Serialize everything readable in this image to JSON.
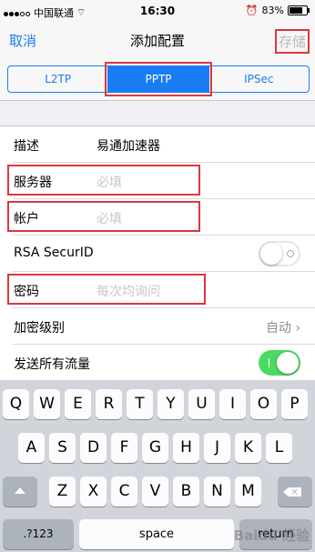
{
  "status": {
    "carrier": "中国联通",
    "time": "16:30",
    "battery": "83%"
  },
  "nav": {
    "cancel": "取消",
    "title": "添加配置",
    "save": "存储"
  },
  "segments": [
    "L2TP",
    "PPTP",
    "IPSec"
  ],
  "form": {
    "description": {
      "label": "描述",
      "value": "易通加速器"
    },
    "server": {
      "label": "服务器",
      "placeholder": "必填"
    },
    "account": {
      "label": "帐户",
      "placeholder": "必填"
    },
    "rsa": {
      "label": "RSA SecurID",
      "on": false
    },
    "password": {
      "label": "密码",
      "placeholder": "每次均询问"
    },
    "encryption": {
      "label": "加密级别",
      "value": "自动"
    },
    "send_all": {
      "label": "发送所有流量",
      "on": true
    }
  },
  "keyboard": {
    "row1": [
      "Q",
      "W",
      "E",
      "R",
      "T",
      "Y",
      "U",
      "I",
      "O",
      "P"
    ],
    "row2": [
      "A",
      "S",
      "D",
      "F",
      "G",
      "H",
      "J",
      "K",
      "L"
    ],
    "row3": [
      "Z",
      "X",
      "C",
      "V",
      "B",
      "N",
      "M"
    ],
    "numbers": ".?123",
    "space": "space",
    "return": "return"
  },
  "watermark": "Baidu 经验"
}
